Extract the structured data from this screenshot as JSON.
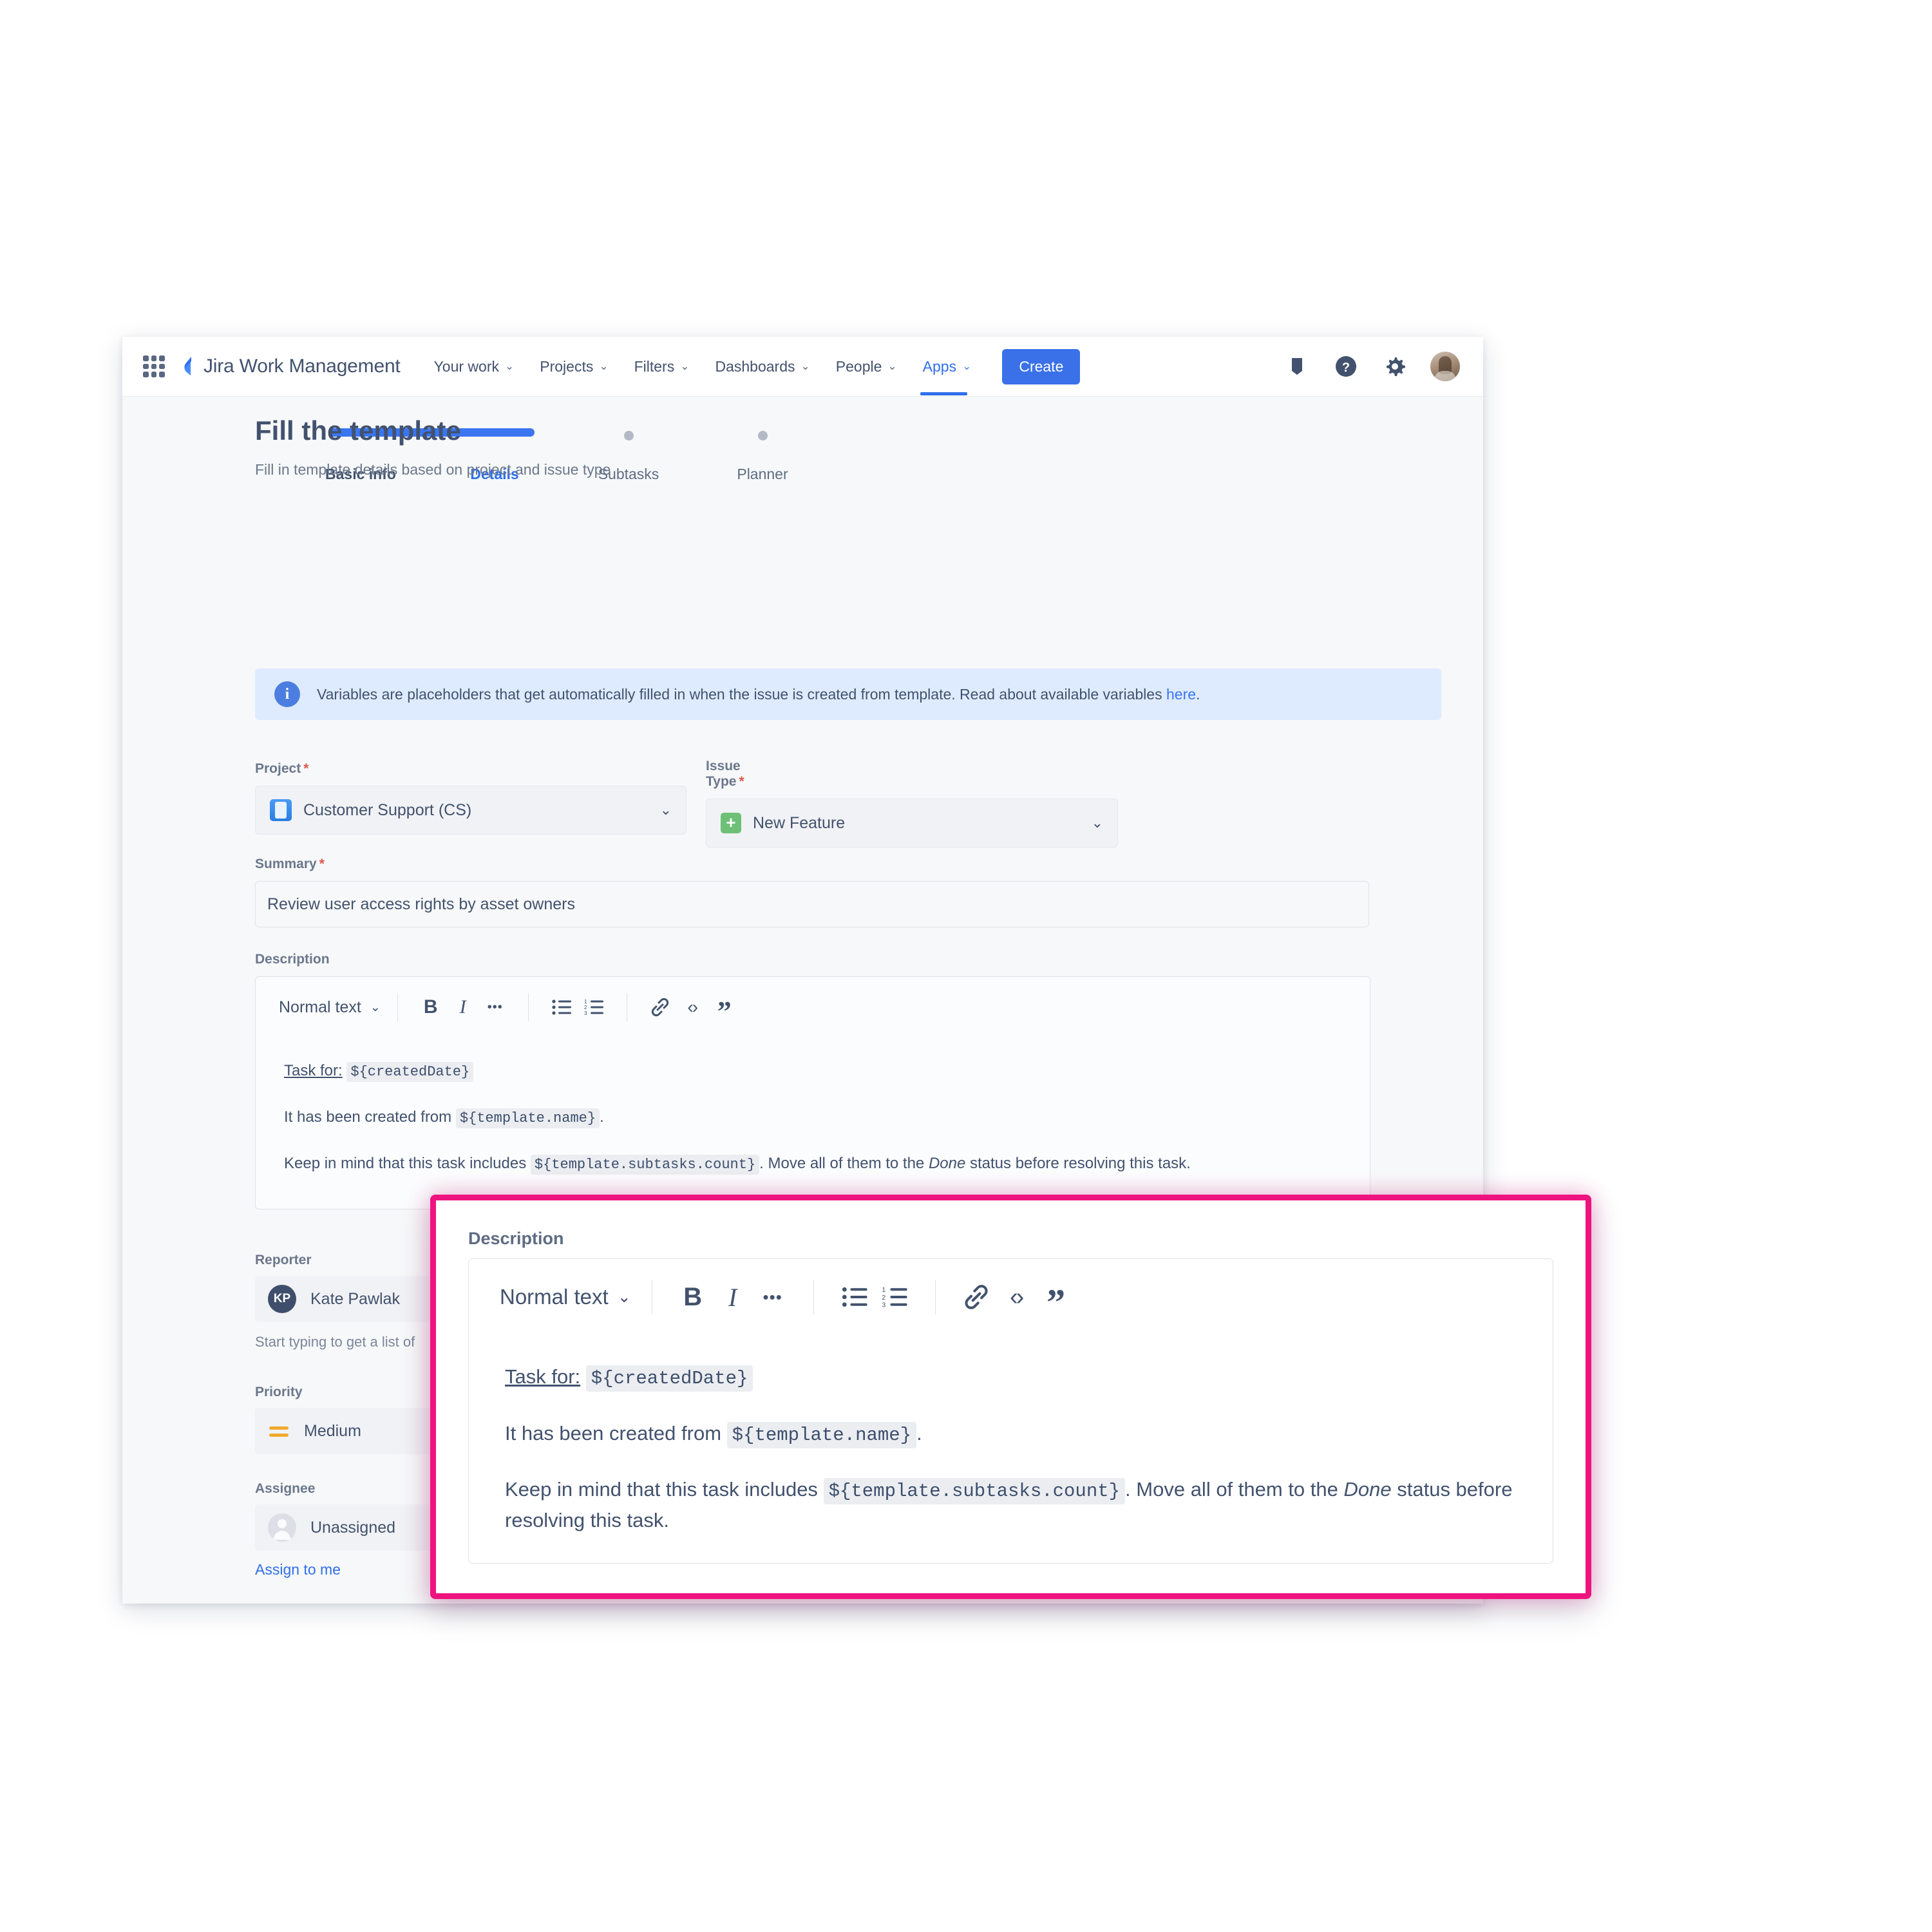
{
  "nav": {
    "brand": "Jira Work Management",
    "items": [
      {
        "label": "Your work",
        "caret": "⌄"
      },
      {
        "label": "Projects",
        "caret": "⌄"
      },
      {
        "label": "Filters",
        "caret": "⌄"
      },
      {
        "label": "Dashboards",
        "caret": "⌄"
      },
      {
        "label": "People",
        "caret": "⌄"
      },
      {
        "label": "Apps",
        "caret": "⌄"
      }
    ],
    "create_label": "Create",
    "icons": [
      "notifications-icon",
      "help-icon",
      "settings-icon",
      "avatar"
    ]
  },
  "stepper": {
    "steps": [
      {
        "label": "Basic info",
        "state": "done"
      },
      {
        "label": "Details",
        "state": "current"
      },
      {
        "label": "Subtasks",
        "state": "upcoming"
      },
      {
        "label": "Planner",
        "state": "upcoming"
      }
    ]
  },
  "page": {
    "title": "Fill the template",
    "subtitle": "Fill in template details based on project and issue type"
  },
  "banner": {
    "text": "Variables are placeholders that get automatically filled in when the issue is created from template. Read about available variables ",
    "link": "here",
    "period": "."
  },
  "form": {
    "project": {
      "label": "Project",
      "required": "*",
      "value": "Customer Support (CS)",
      "caret": "⌄"
    },
    "issue_type": {
      "label": "Issue Type",
      "required": "*",
      "value": "New Feature",
      "icon": "+",
      "caret": "⌄"
    },
    "summary": {
      "label": "Summary",
      "required": "*",
      "value": "Review user access rights by asset owners"
    },
    "description": {
      "label": "Description",
      "toolbar": {
        "style": "Normal text",
        "caret": "⌄",
        "bold": "B",
        "italic": "I",
        "more": "•••",
        "bullet_list": "bullet-list-icon",
        "numbered_list": "numbered-list-icon",
        "link": "link-icon",
        "code": "‹›",
        "quote": "”"
      },
      "body": {
        "line1_label": "Task for:",
        "line1_var": "${createdDate}",
        "line2_pre": "It has been created from",
        "line2_var": "${template.name}",
        "line2_post": ".",
        "line3_pre": "Keep in mind that this task includes",
        "line3_var": "${template.subtasks.count}",
        "line3_mid": ". Move all of them to the",
        "line3_em": "Done",
        "line3_post": "status before resolving this task."
      }
    },
    "reporter": {
      "label": "Reporter",
      "value": "Kate Pawlak",
      "initials": "KP",
      "helper": "Start typing to get a list of"
    },
    "priority": {
      "label": "Priority",
      "value": "Medium"
    },
    "assignee": {
      "label": "Assignee",
      "value": "Unassigned",
      "assign_link": "Assign to me"
    }
  },
  "colors": {
    "accent": "#3a76f0",
    "highlight_border": "#ee137f",
    "banner_bg": "#deebff",
    "issue_green": "#6ec077",
    "priority_amber": "#f0a92e"
  }
}
